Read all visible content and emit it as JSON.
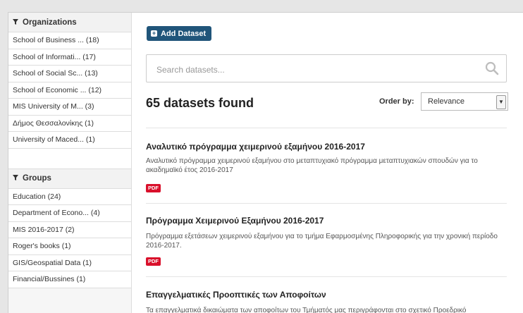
{
  "sidebar": {
    "organizations": {
      "heading": "Organizations",
      "items": [
        "School of Business ... (18)",
        "School of Informati... (17)",
        "School of Social Sc... (13)",
        "School of Economic ... (12)",
        "MIS University of M... (3)",
        "Δήμος Θεσσαλονίκης (1)",
        "University of Maced... (1)"
      ]
    },
    "groups": {
      "heading": "Groups",
      "items": [
        "Education (24)",
        "Department of Econo... (4)",
        "MIS 2016-2017 (2)",
        "Roger's books (1)",
        "GIS/Geospatial Data (1)",
        "Financial/Bussines (1)"
      ]
    }
  },
  "main": {
    "add_dataset_label": "Add Dataset",
    "search_placeholder": "Search datasets...",
    "results_count": "65 datasets found",
    "order_by_label": "Order by:",
    "order_by_value": "Relevance",
    "datasets": [
      {
        "title": "Αναλυτικό πρόγραμμα χειμερινού εξαμήνου 2016-2017",
        "description": "Αναλυτικό πρόγραμμα χειμερινού εξαμήνου στο μεταπτυχιακό πρόγραμμα μεταπτυχιακών σπουδών για το ακαδημαϊκό έτος 2016-2017",
        "format": "PDF"
      },
      {
        "title": "Πρόγραμμα Χειμερινού Εξαμήνου 2016-2017",
        "description": "Πρόγραμμα εξετάσεων χειμερινού εξαμήνου για το τμήμα Εφαρμοσμένης Πληροφορικής για την χρονική περίοδο 2016-2017.",
        "format": "PDF"
      },
      {
        "title": "Επαγγελματικές Προοπτικές των Αποφοίτων",
        "description": "Τα επαγγελματικά δικαιώματα των αποφοίτων του Τμήματός μας περιγράφονται στο σχετικό Προεδρικό"
      }
    ]
  },
  "colors": {
    "primary_button": "#20557a",
    "pdf_badge": "#d9102b"
  },
  "icons": {
    "section_heading": "funnel-icon",
    "add_button": "plus-square-icon",
    "search": "magnifier-icon",
    "select": "chevron-down-icon"
  }
}
